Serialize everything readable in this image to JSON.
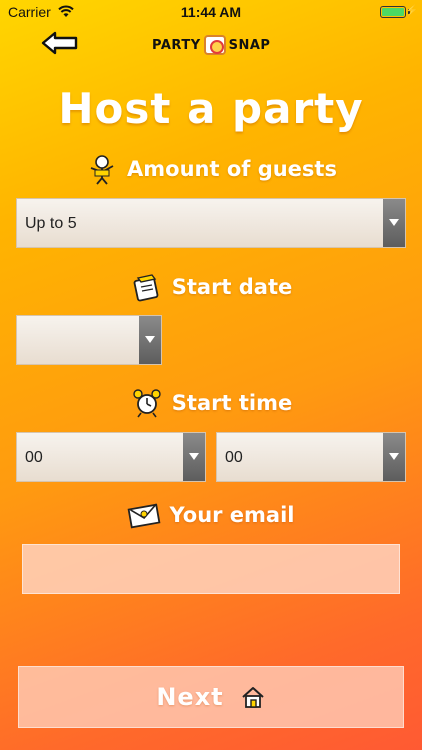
{
  "status_bar": {
    "carrier": "Carrier",
    "time": "11:44 AM",
    "battery_level": 1.0
  },
  "header": {
    "logo_left": "PARTY",
    "logo_right": "SNAP",
    "back_icon": "arrow-left-icon"
  },
  "title": "Host a party",
  "guests": {
    "label": "Amount of guests",
    "selected": "Up to 5"
  },
  "start_date": {
    "label": "Start date",
    "selected": ""
  },
  "start_time": {
    "label": "Start time",
    "hour": "00",
    "minute": "00"
  },
  "email": {
    "label": "Your email",
    "value": "",
    "placeholder": ""
  },
  "next_button": {
    "label": "Next",
    "icon": "house-icon"
  },
  "colors": {
    "gradient_top": "#ffd600",
    "gradient_bottom": "#ff5a33",
    "battery": "#4cd964"
  }
}
